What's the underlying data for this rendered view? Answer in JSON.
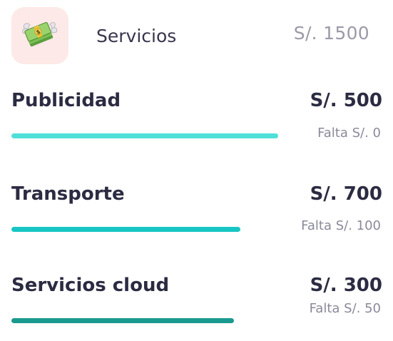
{
  "header": {
    "icon": "money-with-wings-icon",
    "title": "Servicios",
    "amount": "S/. 1500"
  },
  "items": [
    {
      "name": "Publicidad",
      "amount": "S/. 500",
      "remaining": "Falta S/. 0",
      "progress": 1.0,
      "bar_color": "#4fdfd9"
    },
    {
      "name": "Transporte",
      "amount": "S/. 700",
      "remaining": "Falta S/. 100",
      "progress": 0.857,
      "bar_color": "#17c6c4"
    },
    {
      "name": "Servicios cloud",
      "amount": "S/. 300",
      "remaining": "Falta S/. 50",
      "progress": 0.833,
      "bar_color": "#1a9a8e"
    }
  ]
}
